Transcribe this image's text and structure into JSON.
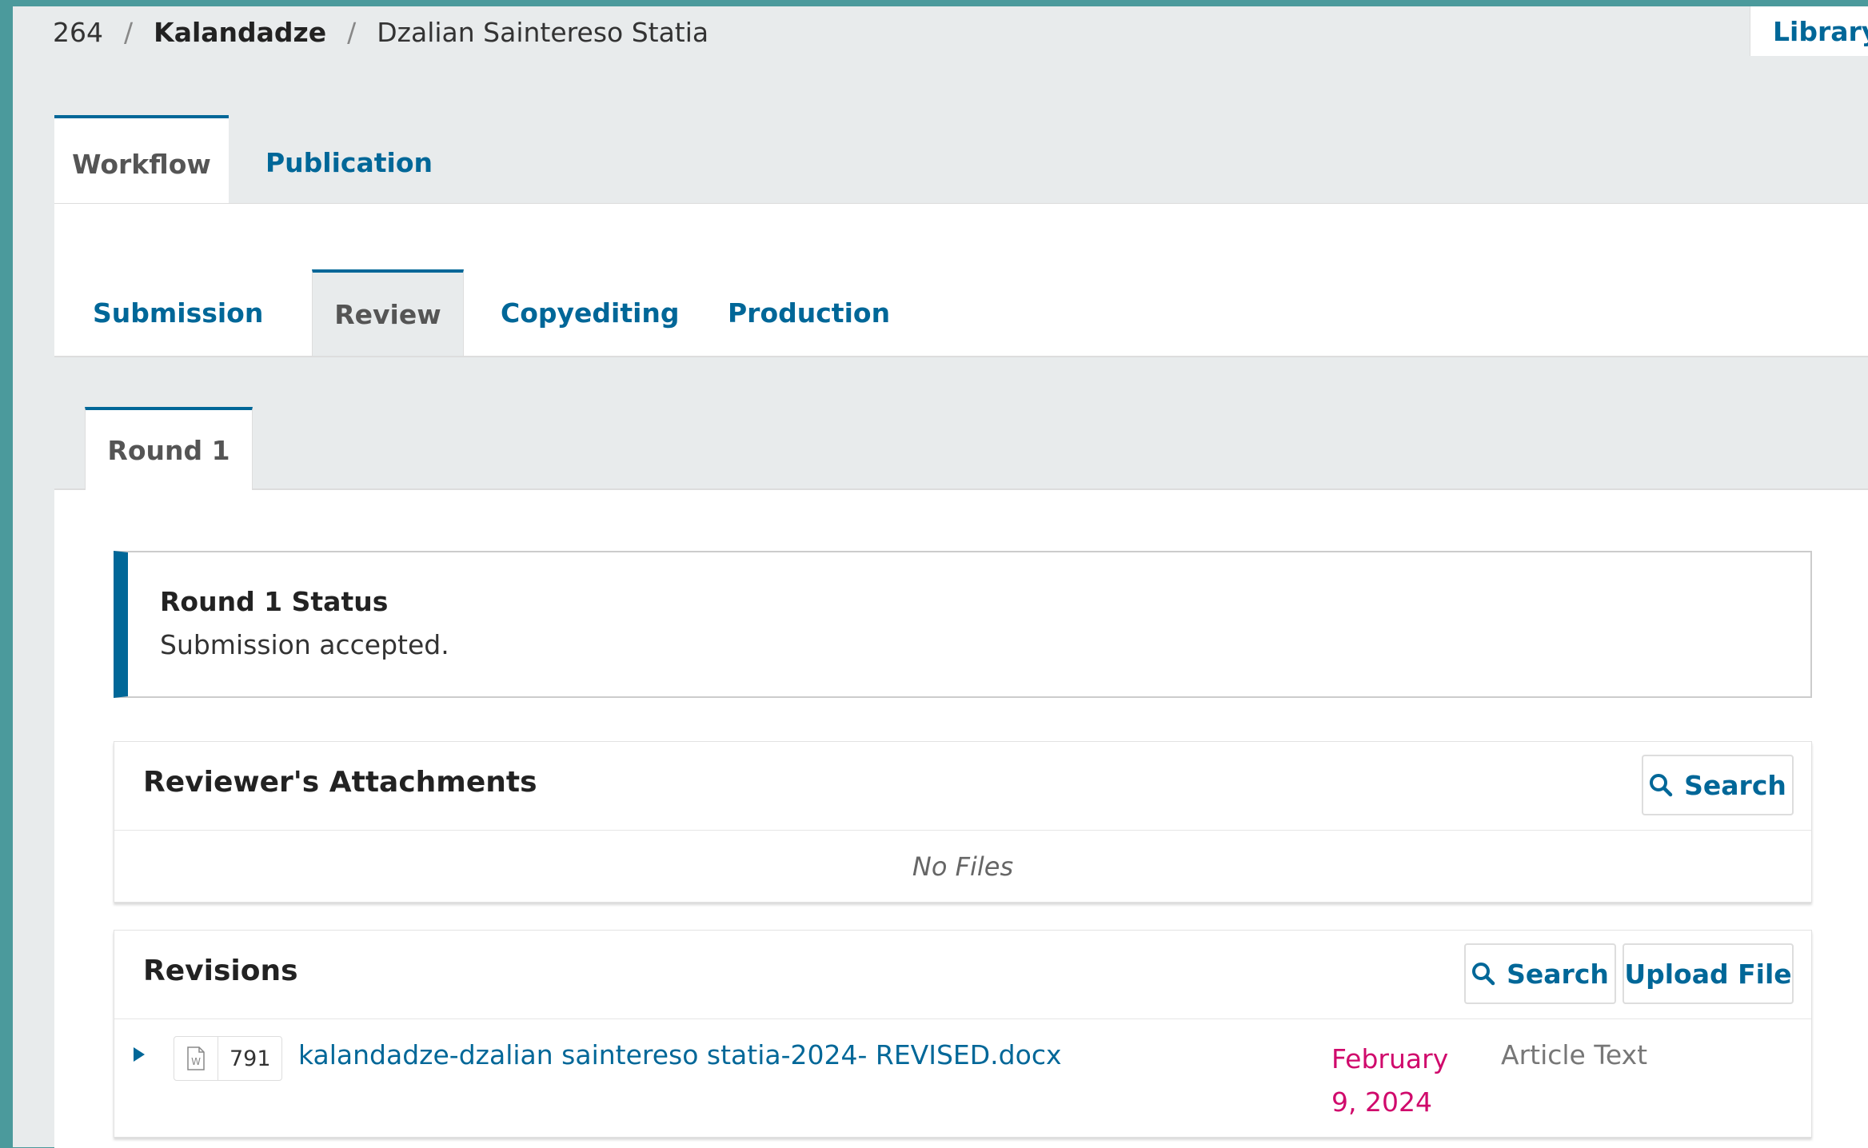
{
  "breadcrumb": {
    "id": "264",
    "separator": "/",
    "author": "Kalandadze",
    "title": "Dzalian Saintereso Statia"
  },
  "header": {
    "library_label": "Library"
  },
  "top_tabs": [
    {
      "label": "Workflow",
      "active": true
    },
    {
      "label": "Publication",
      "active": false
    }
  ],
  "stage_tabs": [
    {
      "label": "Submission",
      "active": false
    },
    {
      "label": "Review",
      "active": true
    },
    {
      "label": "Copyediting",
      "active": false
    },
    {
      "label": "Production",
      "active": false
    }
  ],
  "round_tabs": [
    {
      "label": "Round 1",
      "active": true
    }
  ],
  "round_status": {
    "title": "Round 1 Status",
    "text": "Submission accepted."
  },
  "reviewer_attachments": {
    "title": "Reviewer's Attachments",
    "search_label": "Search",
    "empty_text": "No Files"
  },
  "revisions": {
    "title": "Revisions",
    "search_label": "Search",
    "upload_label": "Upload File",
    "files": [
      {
        "id": "791",
        "icon": "word-file-icon",
        "name": "kalandadze-dzalian saintereso statia-2024- REVISED.docx",
        "date": "February 9, 2024",
        "type": "Article Text"
      }
    ]
  },
  "colors": {
    "accent": "#006798",
    "date": "#d00a6c",
    "frame": "#4b9a9c",
    "panel_bg": "#e8ebec"
  }
}
